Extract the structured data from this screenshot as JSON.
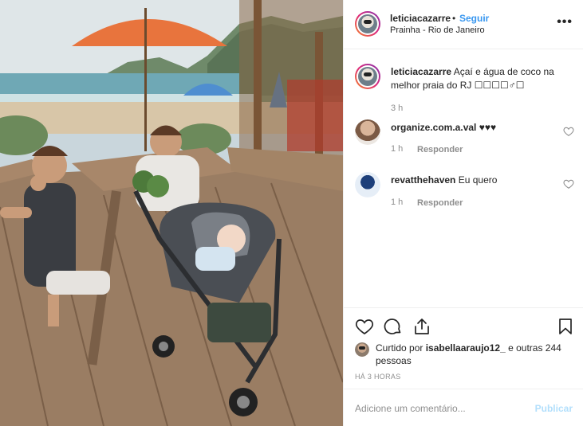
{
  "post": {
    "photo_alt": "",
    "header": {
      "username": "leticiacazarre",
      "separator": "•",
      "follow_label": "Seguir",
      "location": "Prainha - Rio de Janeiro",
      "more_icon": "more-horizontal-icon"
    },
    "caption": {
      "username": "leticiacazarre",
      "text": " Açaí e água de coco na melhor praia do RJ ☐☐☐☐♂☐",
      "time": "3 h"
    },
    "comments": [
      {
        "username": "organize.com.a.val",
        "text": " ♥♥♥",
        "time": "1 h",
        "reply_label": "Responder"
      },
      {
        "username": "revatthehaven",
        "text": " Eu quero",
        "time": "1 h",
        "reply_label": "Responder"
      }
    ],
    "actions": {
      "like_icon": "heart-icon",
      "comment_icon": "comment-icon",
      "share_icon": "share-icon",
      "save_icon": "bookmark-icon"
    },
    "likes": {
      "prefix": "Curtido por ",
      "user": "isabellaaraujo12_",
      "suffix": " e outras 244 pessoas"
    },
    "timeago": "HÁ 3 HORAS",
    "comment_box": {
      "placeholder": "Adicione um comentário...",
      "publish_label": "Publicar"
    }
  },
  "colors": {
    "link_blue": "#3897f0",
    "publish_disabled": "#b2dffc",
    "muted_text": "#8e8e8e",
    "divider": "#efefef"
  }
}
